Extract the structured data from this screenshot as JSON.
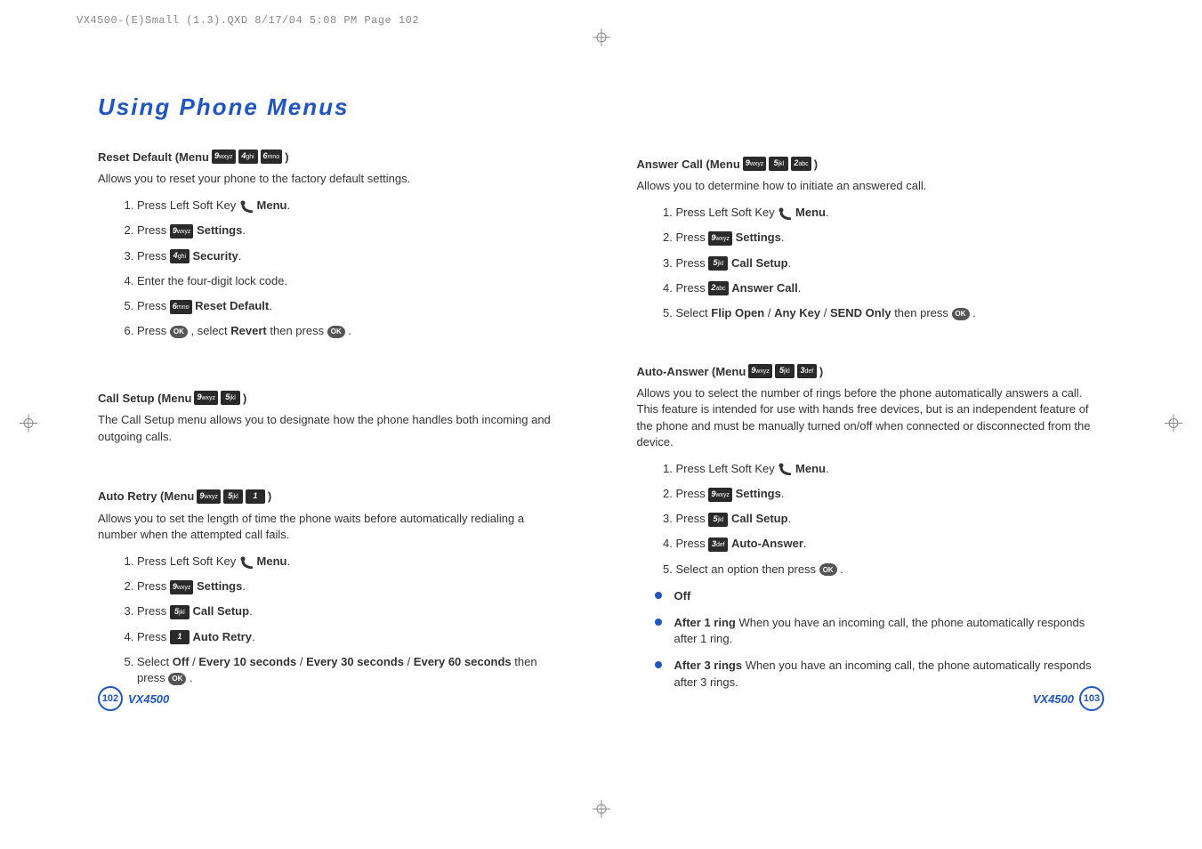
{
  "header": "VX4500-(E)Small (1.3).QXD  8/17/04  5:08 PM  Page 102",
  "title": "Using Phone Menus",
  "left": {
    "s1": {
      "head_a": "Reset Default (Menu",
      "k1": "9",
      "k1s": "wxyz",
      "k2": "4",
      "k2s": "ghi",
      "k3": "6",
      "k3s": "mno",
      "head_b": ")",
      "desc": "Allows you to reset your phone to the factory default settings.",
      "steps": {
        "1a": "Press Left Soft Key",
        "1b": "Menu",
        "2a": "Press",
        "2k": "9",
        "2ks": "wxyz",
        "2b": "Settings",
        "3a": "Press",
        "3k": "4",
        "3ks": "ghi",
        "3b": "Security",
        "4": "Enter the four-digit lock code.",
        "5a": "Press",
        "5k": "6",
        "5ks": "mno",
        "5b": "Reset Default",
        "6a": "Press",
        "6b": ", select",
        "6c": "Revert",
        "6d": "then press"
      }
    },
    "s2": {
      "head_a": "Call Setup (Menu",
      "k1": "9",
      "k1s": "wxyz",
      "k2": "5",
      "k2s": "jkl",
      "head_b": ")",
      "desc": "The Call Setup menu allows you to designate how the phone handles both incoming and outgoing calls."
    },
    "s3": {
      "head_a": "Auto Retry (Menu",
      "k1": "9",
      "k1s": "wxyz",
      "k2": "5",
      "k2s": "jkl",
      "k3": "1",
      "k3s": "",
      "head_b": ")",
      "desc": "Allows you to set the length of time the phone waits before automatically redialing a number when the attempted call fails.",
      "steps": {
        "1a": "Press Left Soft Key",
        "1b": "Menu",
        "2a": "Press",
        "2k": "9",
        "2ks": "wxyz",
        "2b": "Settings",
        "3a": "Press",
        "3k": "5",
        "3ks": "jkl",
        "3b": "Call Setup",
        "4a": "Press",
        "4k": "1",
        "4ks": "",
        "4b": "Auto Retry",
        "5a": "Select",
        "5b": "Off",
        "5c": "Every 10 seconds",
        "5d": "Every 30 seconds",
        "5e": "Every 60 seconds",
        "5f": "then press"
      }
    }
  },
  "right": {
    "s1": {
      "head_a": "Answer Call (Menu",
      "k1": "9",
      "k1s": "wxyz",
      "k2": "5",
      "k2s": "jkl",
      "k3": "2",
      "k3s": "abc",
      "head_b": ")",
      "desc": "Allows you to determine how to initiate an answered call.",
      "steps": {
        "1a": "Press Left Soft Key",
        "1b": "Menu",
        "2a": "Press",
        "2k": "9",
        "2ks": "wxyz",
        "2b": "Settings",
        "3a": "Press",
        "3k": "5",
        "3ks": "jkl",
        "3b": "Call Setup",
        "4a": "Press",
        "4k": "2",
        "4ks": "abc",
        "4b": "Answer Call",
        "5a": "Select",
        "5b": "Flip Open",
        "5c": "Any Key",
        "5d": "SEND Only",
        "5e": "then press"
      }
    },
    "s2": {
      "head_a": "Auto-Answer (Menu",
      "k1": "9",
      "k1s": "wxyz",
      "k2": "5",
      "k2s": "jkl",
      "k3": "3",
      "k3s": "def",
      "head_b": ")",
      "desc": "Allows you to select the number of rings before the phone automatically answers a call. This feature is intended for use with hands free devices, but is an independent feature of the phone and must be manually turned on/off when connected or disconnected from the device.",
      "steps": {
        "1a": "Press Left Soft Key",
        "1b": "Menu",
        "2a": "Press",
        "2k": "9",
        "2ks": "wxyz",
        "2b": "Settings",
        "3a": "Press",
        "3k": "5",
        "3ks": "jkl",
        "3b": "Call Setup",
        "4a": "Press",
        "4k": "3",
        "4ks": "def",
        "4b": "Auto-Answer",
        "5a": "Select an option then press"
      },
      "bullets": {
        "b1": "Off",
        "b2a": "After 1 ring",
        "b2b": "When you have an incoming call, the phone automatically responds after 1 ring.",
        "b3a": "After 3 rings",
        "b3b": "When you have an incoming call, the phone automatically responds after 3 rings."
      }
    }
  },
  "footer": {
    "pageLeft": "102",
    "pageRight": "103",
    "model": "VX4500"
  },
  "ok": "OK"
}
